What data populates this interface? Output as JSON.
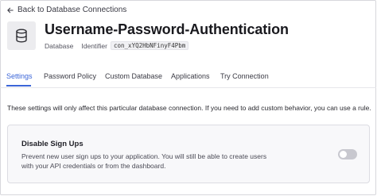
{
  "back_link": {
    "label": "Back to Database Connections"
  },
  "header": {
    "title": "Username-Password-Authentication",
    "type_label": "Database",
    "identifier_label": "Identifier",
    "identifier_value": "con_xYQ2HbNFinyF4Pbm"
  },
  "tabs": [
    {
      "label": "Settings",
      "active": true
    },
    {
      "label": "Password Policy",
      "active": false
    },
    {
      "label": "Custom Database",
      "active": false
    },
    {
      "label": "Applications",
      "active": false
    },
    {
      "label": "Try Connection",
      "active": false
    }
  ],
  "notice": "These settings will only affect this particular database connection. If you need to add custom behavior, you can use a rule.",
  "setting": {
    "title": "Disable Sign Ups",
    "description": "Prevent new user sign ups to your application. You will still be able to create users with your API credentials or from the dashboard.",
    "enabled": false
  },
  "colors": {
    "accent": "#3b65d8",
    "toggle_off": "#c8c8cf"
  }
}
